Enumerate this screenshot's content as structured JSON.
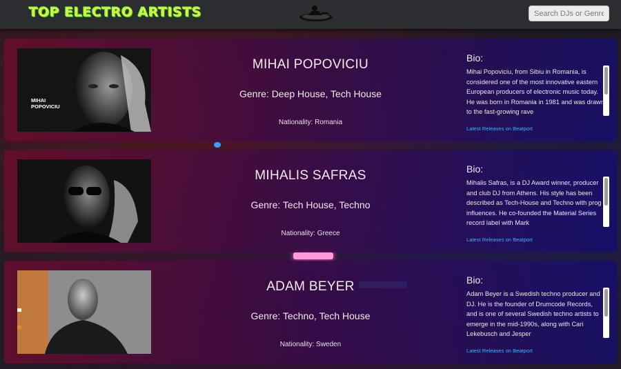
{
  "header": {
    "brand": "TOP ELECTRO ARTISTS",
    "logo_icon": "dj-turntable-icon",
    "search_placeholder": "Search DJs or Genres"
  },
  "artists": [
    {
      "name": "MIHAI POPOVICIU",
      "photo_caption_line1": "MIHAI",
      "photo_caption_line2": "POPOVICIU",
      "genre": "Genre: Deep House, Tech House",
      "nationality": "Nationality: Romania",
      "bio_label": "Bio:",
      "bio": "Mihai Popoviciu, from Sibiu in Romania, is considered one of the most innovative eastern European producers of electronic music today. He was born in Romania in 1981 and was drawn to the fast-growing rave",
      "link": "Latest Releases on Beatport"
    },
    {
      "name": "MIHALIS SAFRAS",
      "genre": "Genre: Tech House, Techno",
      "nationality": "Nationality: Greece",
      "bio_label": "Bio:",
      "bio": "Mihalis Safras, is a DJ Award winner, producer and club DJ from Athens. His style has been described as Tech-House and Techno with prog influences. He co-founded the Material Series record label with Mark",
      "link": "Latest Releases on Beatport"
    },
    {
      "name": "ADAM BEYER",
      "genre": "Genre: Techno, Tech House",
      "nationality": "Nationality: Sweden",
      "bio_label": "Bio:",
      "bio": "Adam Beyer is a Swedish techno producer and DJ. He is the founder of Drumcode Records, and is one of several Swedish techno artists to emerge in the mid-1990s, along with Cari Lekebusch and Jesper",
      "link": "Latest Releases on Beatport"
    }
  ],
  "colors": {
    "brand_text": "#d8f03a",
    "navbar": "#2b2d30",
    "link": "#38b6ff",
    "card_gradient_start": "#6e0c2d",
    "card_gradient_end": "#160e6e"
  }
}
